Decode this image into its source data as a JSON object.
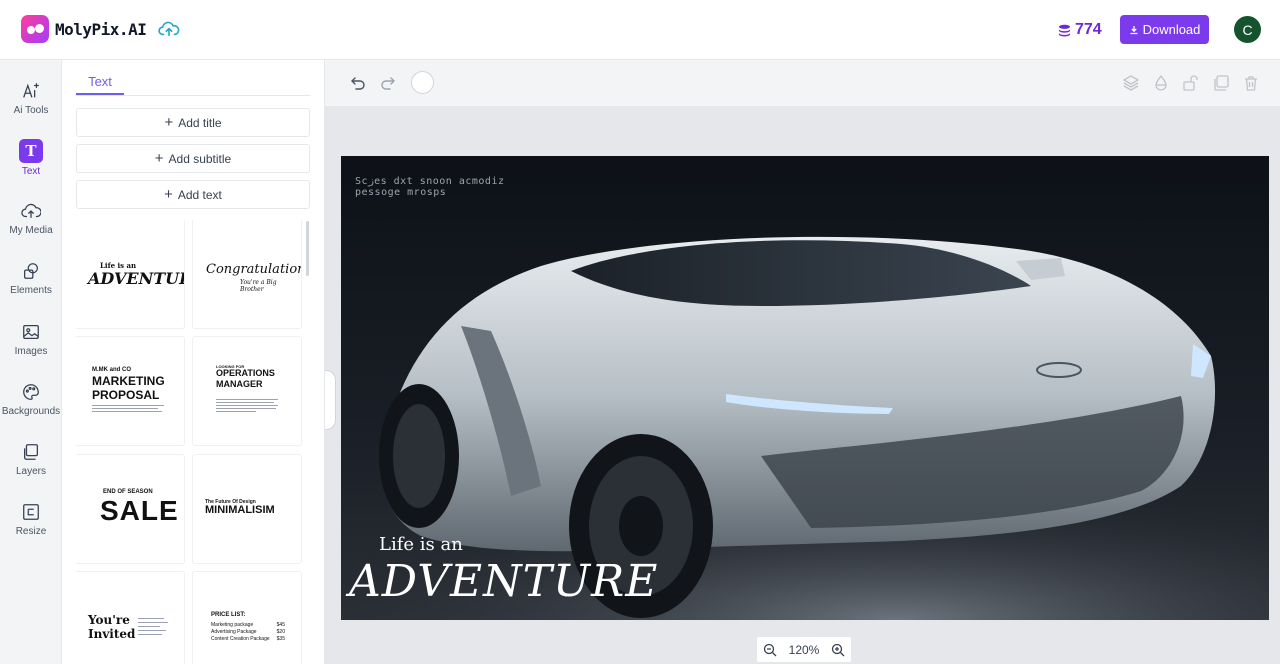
{
  "app": {
    "brand": "MolyPix.AI",
    "credits": "774",
    "download_label": "Download",
    "avatar_initial": "C"
  },
  "rail": {
    "items": [
      {
        "label": "Ai Tools",
        "icon": "ai-sparkle-icon"
      },
      {
        "label": "Text",
        "icon": "text-icon"
      },
      {
        "label": "My Media",
        "icon": "upload-icon"
      },
      {
        "label": "Elements",
        "icon": "shapes-icon"
      },
      {
        "label": "Images",
        "icon": "image-icon"
      },
      {
        "label": "Backgrounds",
        "icon": "palette-icon"
      },
      {
        "label": "Layers",
        "icon": "layers-icon"
      },
      {
        "label": "Resize",
        "icon": "resize-icon"
      }
    ],
    "active_icon_glyph": "T"
  },
  "panel": {
    "tab_label": "Text",
    "add_title": "Add title",
    "add_subtitle": "Add subtitle",
    "add_text": "Add text",
    "templates": {
      "adventure": {
        "small": "Life is an",
        "big": "ADVENTURE"
      },
      "congrats": {
        "big": "Congratulations!",
        "small": "You're a Big Brother"
      },
      "marketing": {
        "small": "M.MK and CO",
        "big1": "MARKETING",
        "big2": "PROPOSAL"
      },
      "operations": {
        "small": "LOOKING FOR",
        "big1": "OPERATIONS",
        "big2": "MANAGER"
      },
      "sale": {
        "small": "END OF SEASON",
        "big": "SALE"
      },
      "minimalism": {
        "small": "The Future Of Design",
        "big": "MINIMALISIM"
      },
      "invited": {
        "big1": "You're",
        "big2": "Invited"
      },
      "pricelist": {
        "title": "PRICE LIST:",
        "rows": [
          {
            "item": "Marketing package",
            "price": "$45"
          },
          {
            "item": "Advertising Package",
            "price": "$20"
          },
          {
            "item": "Content Creation Package",
            "price": "$35"
          }
        ]
      }
    }
  },
  "canvas": {
    "caption_line1": "Scزes dxt snoon acmodiz",
    "caption_line2": "pessoge mrosps",
    "overlay_small": "Life is an",
    "overlay_big": "ADVENTURE"
  },
  "zoom": {
    "value": "120%"
  },
  "colors": {
    "accent": "#7c3aed",
    "avatar": "#14532d",
    "credits": "#6d28d9"
  }
}
